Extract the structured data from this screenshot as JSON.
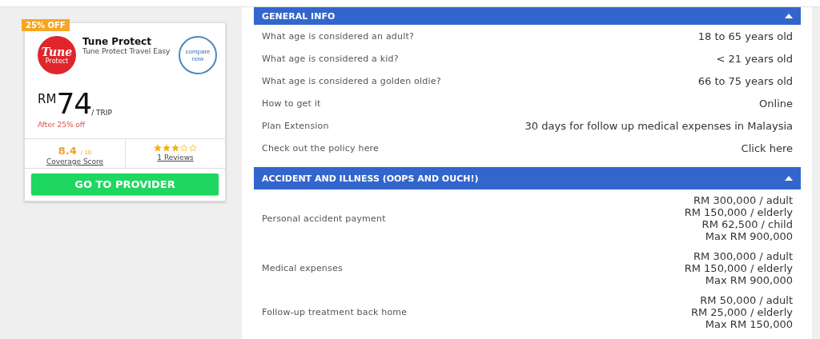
{
  "card": {
    "badge": "25% OFF",
    "logo": {
      "line_1": "Tune",
      "line_2": "Protect"
    },
    "brand": "Tune Protect",
    "plan": "Tune Protect Travel Easy",
    "compare": "compare now",
    "currency": "RM",
    "price": "74",
    "unit": "/ TRIP",
    "discount_note": "After 25% off",
    "score": "8.4",
    "score_max": "/ 10",
    "score_label": "Coverage Score",
    "stars": 3,
    "reviews": "1 Reviews",
    "cta": "GO TO PROVIDER"
  },
  "sections": [
    {
      "title": "GENERAL INFO",
      "expanded": true,
      "rows": [
        {
          "label": "What age is considered an adult?",
          "values": [
            "18 to 65 years old"
          ]
        },
        {
          "label": "What age is considered a kid?",
          "values": [
            "< 21 years old"
          ]
        },
        {
          "label": "What age is considered a golden oldie?",
          "values": [
            "66 to 75 years old"
          ]
        },
        {
          "label": "How to get it",
          "values": [
            "Online"
          ]
        },
        {
          "label": "Plan Extension",
          "values": [
            "30 days for follow up medical expenses in Malaysia"
          ]
        },
        {
          "label": "Check out the policy here",
          "values": [
            "Click here"
          ]
        }
      ]
    },
    {
      "title": "ACCIDENT AND ILLNESS (OOPS AND OUCH!)",
      "expanded": true,
      "rows": [
        {
          "label": "Personal accident payment",
          "values": [
            "RM 300,000 / adult",
            "RM 150,000 / elderly",
            "RM 62,500 / child",
            "Max RM 900,000"
          ]
        },
        {
          "label": "Medical expenses",
          "values": [
            "RM 300,000 / adult",
            "RM 150,000 / elderly",
            "Max RM 900,000"
          ]
        },
        {
          "label": "Follow-up treatment back home",
          "values": [
            "RM 50,000 / adult",
            "RM 25,000 / elderly",
            "Max RM 150,000"
          ]
        }
      ]
    }
  ]
}
